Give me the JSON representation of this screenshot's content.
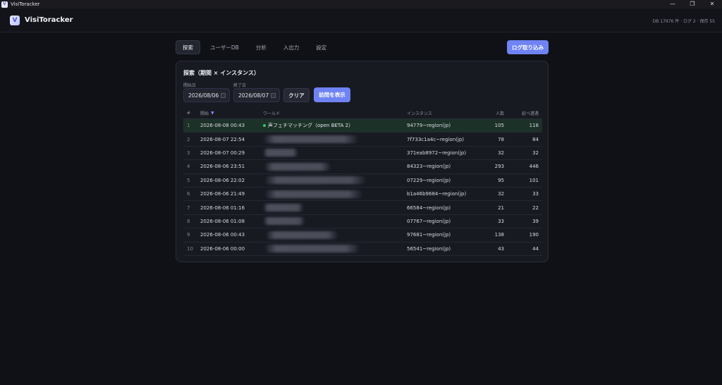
{
  "os": {
    "title": "VisiToracker",
    "app_icon": "V",
    "controls": {
      "minimize": "—",
      "maximize": "❐",
      "close": "✕"
    }
  },
  "header": {
    "logo": "V",
    "app_name": "VisiToracker",
    "stats": "DB 17976 件 · ログ 2 · 保存 55"
  },
  "nav": {
    "tabs": [
      {
        "label": "探索",
        "active": true
      },
      {
        "label": "ユーザーDB",
        "active": false
      },
      {
        "label": "分析",
        "active": false
      },
      {
        "label": "入出力",
        "active": false
      },
      {
        "label": "設定",
        "active": false
      }
    ],
    "import_label": "ログ取り込み"
  },
  "search": {
    "title": "探索（期間 × インスタンス）",
    "start_label": "開始日",
    "start_value": "2026/08/06",
    "end_label": "終了日",
    "end_value": "2026/08/07",
    "clear_label": "クリア",
    "show_label": "訪問を表示"
  },
  "table": {
    "headers": {
      "num": "#",
      "start": "開始",
      "world": "ワールド",
      "instance": "インスタンス",
      "count": "人数",
      "total": "延べ遭遇"
    },
    "sort_icon": "▼",
    "rows": [
      {
        "num": "1",
        "start": "2026-08-08 00:43",
        "world": "声フェチマッチング（open BETA 2）",
        "instance": "94779~region(jp)",
        "count": "105",
        "total": "118",
        "highlight": true
      },
      {
        "num": "2",
        "start": "2026-08-07 22:54",
        "world": "",
        "instance": "7f733c1a4c~region(jp)",
        "count": "78",
        "total": "84"
      },
      {
        "num": "3",
        "start": "2026-08-07 00:29",
        "world": "",
        "instance": "371eab8972~region(jp)",
        "count": "32",
        "total": "32"
      },
      {
        "num": "4",
        "start": "2026-08-06 23:51",
        "world": "",
        "instance": "84323~region(jp)",
        "count": "293",
        "total": "446"
      },
      {
        "num": "5",
        "start": "2026-08-06 22:02",
        "world": "",
        "instance": "07229~region(jp)",
        "count": "95",
        "total": "101"
      },
      {
        "num": "6",
        "start": "2026-08-06 21:49",
        "world": "",
        "instance": "b1a46b9684~region(jp)",
        "count": "32",
        "total": "33"
      },
      {
        "num": "7",
        "start": "2026-08-06 01:16",
        "world": "",
        "instance": "66584~region(jp)",
        "count": "21",
        "total": "22"
      },
      {
        "num": "8",
        "start": "2026-08-06 01:08",
        "world": "",
        "instance": "07767~region(jp)",
        "count": "33",
        "total": "39"
      },
      {
        "num": "9",
        "start": "2026-08-06 00:43",
        "world": "",
        "instance": "97681~region(jp)",
        "count": "138",
        "total": "190"
      },
      {
        "num": "10",
        "start": "2026-08-06 00:00",
        "world": "",
        "instance": "56541~region(jp)",
        "count": "43",
        "total": "44"
      }
    ]
  },
  "colors": {
    "accent": "#6f83f4",
    "highlight_row": "#1c3127",
    "online_dot": "#3fbf74",
    "background": "#101116",
    "card": "#181a22"
  }
}
